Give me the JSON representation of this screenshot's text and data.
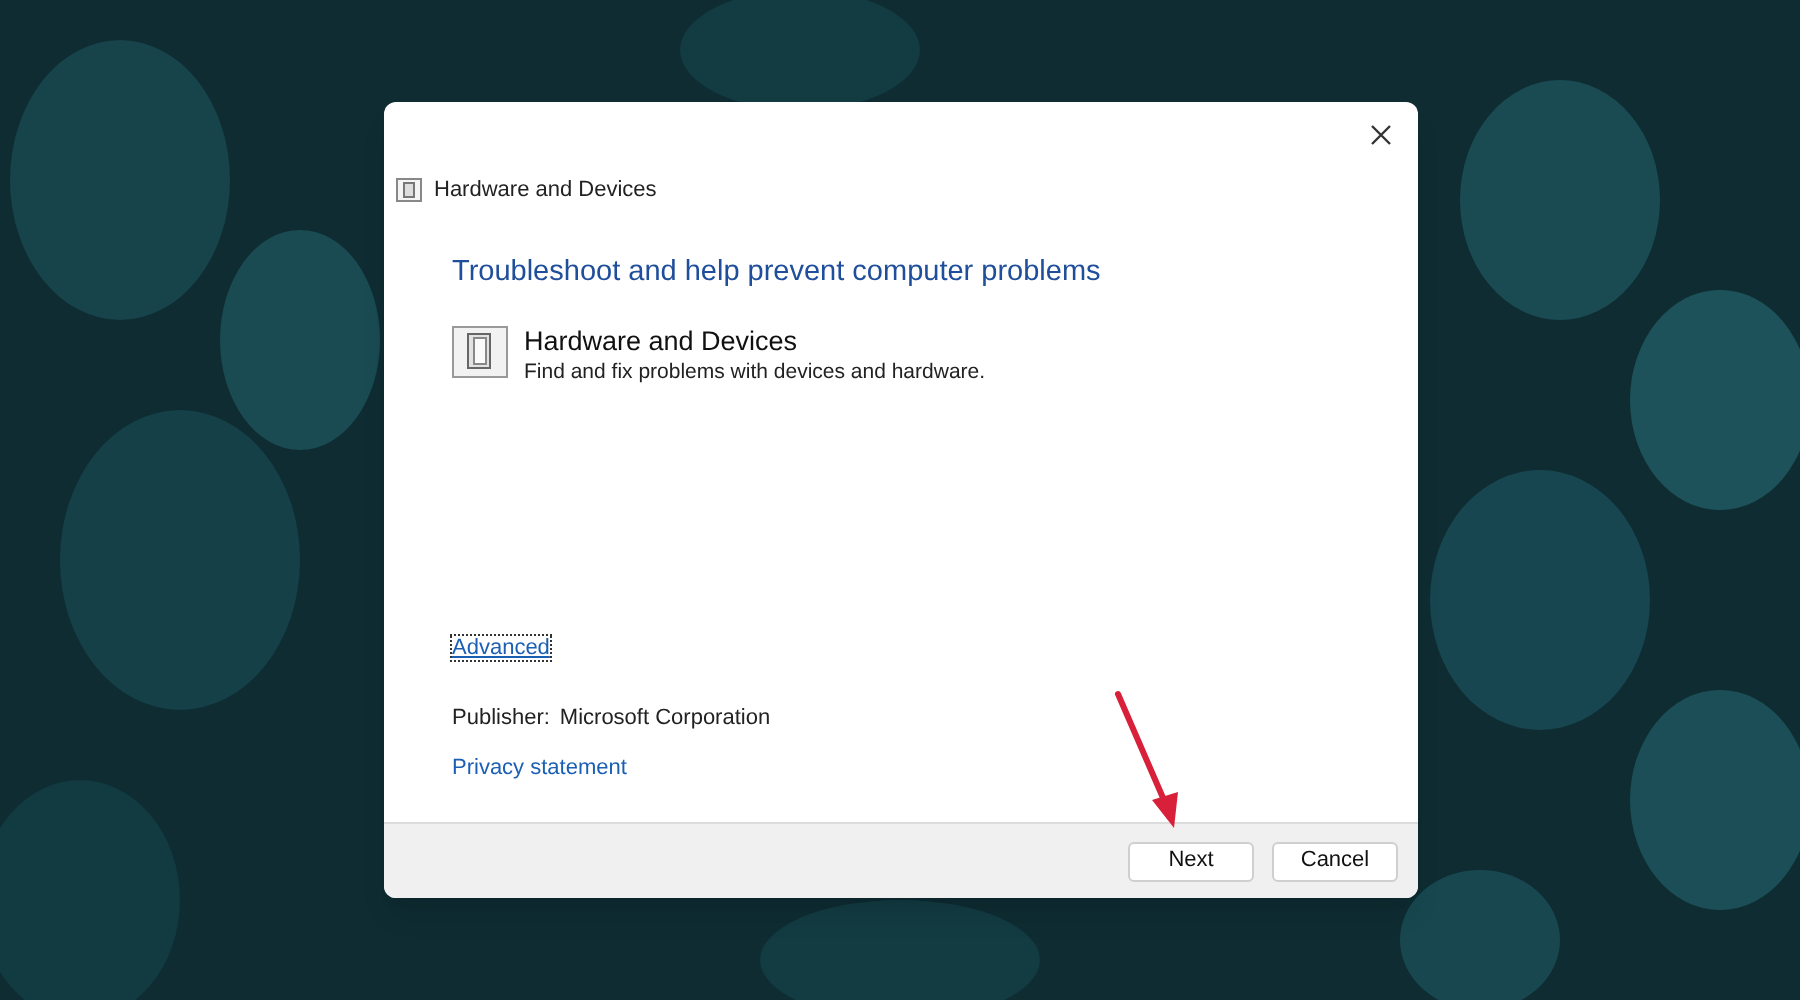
{
  "window": {
    "title": "Hardware and Devices"
  },
  "heading": "Troubleshoot and help prevent computer problems",
  "troubleshooter": {
    "title": "Hardware and Devices",
    "description": "Find and fix problems with devices and hardware."
  },
  "advanced_link": "Advanced",
  "publisher": {
    "label": "Publisher:",
    "value": "Microsoft Corporation"
  },
  "privacy_link": "Privacy statement",
  "buttons": [
    "Next",
    "Cancel"
  ]
}
